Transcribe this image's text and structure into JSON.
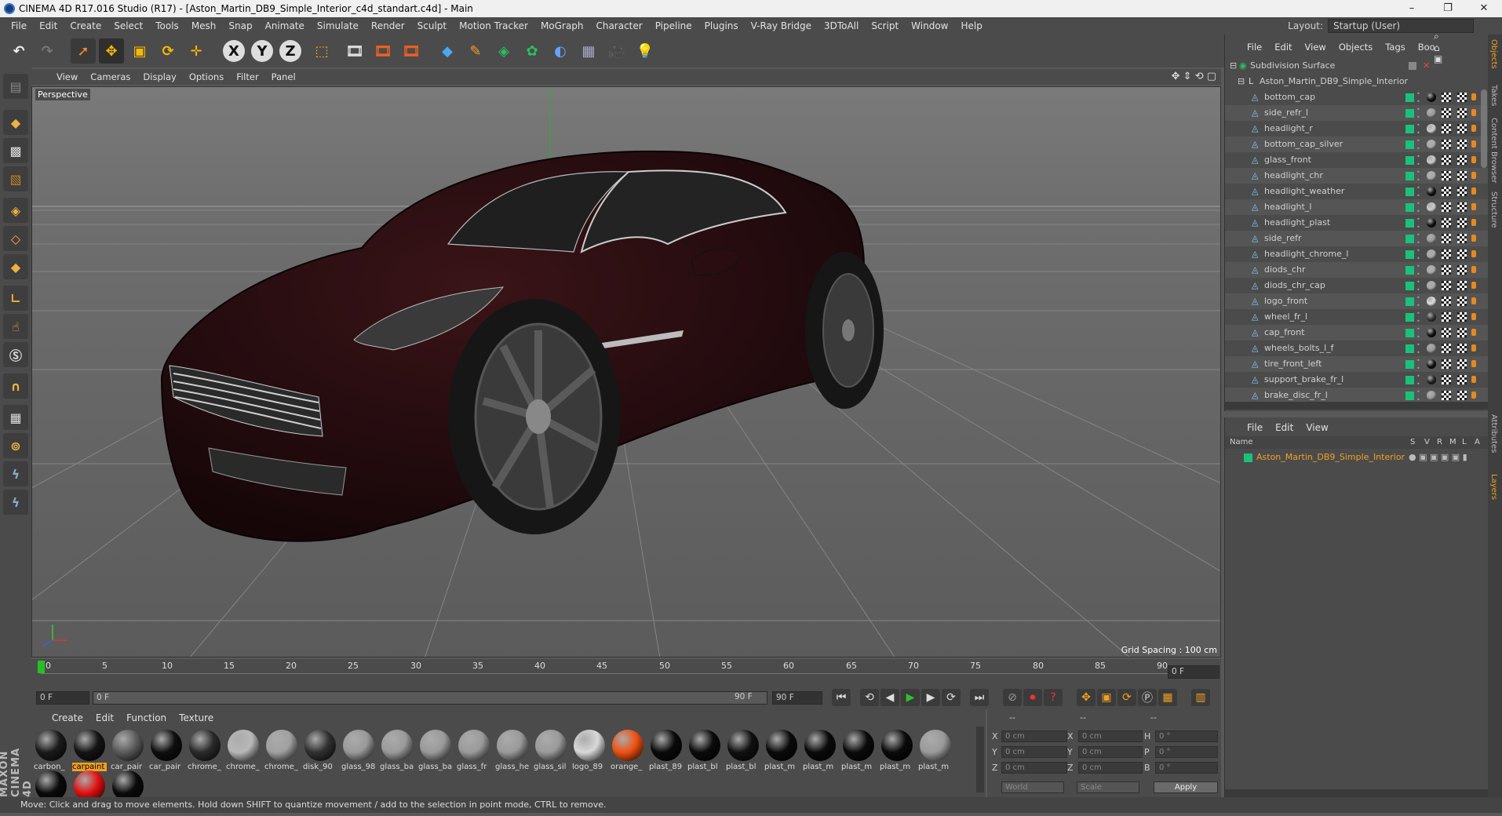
{
  "window": {
    "title": "CINEMA 4D R17.016 Studio (R17) - [Aston_Martin_DB9_Simple_Interior_c4d_standart.c4d] - Main"
  },
  "menu": [
    "File",
    "Edit",
    "Create",
    "Select",
    "Tools",
    "Mesh",
    "Snap",
    "Animate",
    "Simulate",
    "Render",
    "Sculpt",
    "Motion Tracker",
    "MoGraph",
    "Character",
    "Pipeline",
    "Plugins",
    "V-Ray Bridge",
    "3DToAll",
    "Script",
    "Window",
    "Help"
  ],
  "layout": {
    "label": "Layout:",
    "value": "Startup (User)"
  },
  "viewport": {
    "menu": [
      "View",
      "Cameras",
      "Display",
      "Options",
      "Filter",
      "Panel"
    ],
    "camera": "Perspective",
    "grid_spacing": "Grid Spacing : 100 cm"
  },
  "timeline": {
    "ticks": [
      "0",
      "5",
      "10",
      "15",
      "20",
      "25",
      "30",
      "35",
      "40",
      "45",
      "50",
      "55",
      "60",
      "65",
      "70",
      "75",
      "80",
      "85",
      "90"
    ],
    "current_frame": "0 F",
    "start_field": "0 F",
    "slider_start": "0 F",
    "slider_end": "90 F",
    "end_field": "90 F"
  },
  "materials": {
    "menu": [
      "Create",
      "Edit",
      "Function",
      "Texture"
    ],
    "items": [
      {
        "label": "carbon_",
        "color": "#1a1a1a"
      },
      {
        "label": "carpaint",
        "color": "#141414",
        "selected": true
      },
      {
        "label": "car_pair",
        "color": "#5a5a5a"
      },
      {
        "label": "car_pair",
        "color": "#0f0f0f"
      },
      {
        "label": "chrome_",
        "color": "#2a2a2a"
      },
      {
        "label": "chrome_",
        "color": "#b8b8b8"
      },
      {
        "label": "chrome_",
        "color": "#a0a0a0"
      },
      {
        "label": "disk_90",
        "color": "#303030"
      },
      {
        "label": "glass_98",
        "color": "#9a9a9a"
      },
      {
        "label": "glass_ba",
        "color": "#9a9a9a"
      },
      {
        "label": "glass_ba",
        "color": "#9a9a9a"
      },
      {
        "label": "glass_fr",
        "color": "#9a9a9a"
      },
      {
        "label": "glass_he",
        "color": "#9a9a9a"
      },
      {
        "label": "glass_sil",
        "color": "#9a9a9a"
      },
      {
        "label": "logo_89",
        "color": "#d8d8d8"
      },
      {
        "label": "orange_",
        "color": "#f05010"
      },
      {
        "label": "plast_89",
        "color": "#0a0a0a"
      },
      {
        "label": "plast_bl",
        "color": "#0a0a0a"
      },
      {
        "label": "plast_bl",
        "color": "#101010"
      },
      {
        "label": "plast_m",
        "color": "#0a0a0a"
      },
      {
        "label": "plast_m",
        "color": "#0a0a0a"
      },
      {
        "label": "plast_m",
        "color": "#0a0a0a"
      },
      {
        "label": "plast_m",
        "color": "#0a0a0a"
      },
      {
        "label": "plast_m",
        "color": "#9a9a9a"
      },
      {
        "label": "",
        "color": "#0a0a0a"
      },
      {
        "label": "",
        "color": "#e01010"
      },
      {
        "label": "",
        "color": "#0a0a0a"
      }
    ]
  },
  "coords": {
    "header": [
      "--",
      "--",
      "--"
    ],
    "rows": [
      {
        "a": "X",
        "av": "0 cm",
        "b": "X",
        "bv": "0 cm",
        "c": "H",
        "cv": "0 °"
      },
      {
        "a": "Y",
        "av": "0 cm",
        "b": "Y",
        "bv": "0 cm",
        "c": "P",
        "cv": "0 °"
      },
      {
        "a": "Z",
        "av": "0 cm",
        "b": "Z",
        "bv": "0 cm",
        "c": "B",
        "cv": "0 °"
      }
    ],
    "space": "World",
    "mode": "Scale",
    "apply": "Apply"
  },
  "objects": {
    "menu": [
      "File",
      "Edit",
      "View",
      "Objects",
      "Tags",
      "Boo"
    ],
    "root": "Subdivision Surface",
    "group": "Aston_Martin_DB9_Simple_Interior",
    "children": [
      {
        "name": "bottom_cap",
        "ball": "#111"
      },
      {
        "name": "side_refr_l",
        "ball": "#999"
      },
      {
        "name": "headlight_r",
        "ball": "#ccc"
      },
      {
        "name": "bottom_cap_silver",
        "ball": "#aaa"
      },
      {
        "name": "glass_front",
        "ball": "#ccc"
      },
      {
        "name": "headlight_chr",
        "ball": "#aaa"
      },
      {
        "name": "headlight_weather",
        "ball": "#111"
      },
      {
        "name": "headlight_l",
        "ball": "#ccc"
      },
      {
        "name": "headlight_plast",
        "ball": "#111"
      },
      {
        "name": "side_refr",
        "ball": "#999"
      },
      {
        "name": "headlight_chrome_l",
        "ball": "#aaa"
      },
      {
        "name": "diods_chr",
        "ball": "#aaa"
      },
      {
        "name": "diods_chr_cap",
        "ball": "#aaa"
      },
      {
        "name": "logo_front",
        "ball": "#ddd"
      },
      {
        "name": "wheel_fr_l",
        "ball": "#333"
      },
      {
        "name": "cap_front",
        "ball": "#111"
      },
      {
        "name": "wheels_bolts_l_f",
        "ball": "#999"
      },
      {
        "name": "tire_front_left",
        "ball": "#111"
      },
      {
        "name": "support_brake_fr_l",
        "ball": "#222"
      },
      {
        "name": "brake_disc_fr_l",
        "ball": "#999"
      }
    ]
  },
  "layers": {
    "menu": [
      "File",
      "Edit",
      "View"
    ],
    "cols": [
      "Name",
      "S",
      "V",
      "R",
      "M",
      "L",
      "A"
    ],
    "item": "Aston_Martin_DB9_Simple_Interior"
  },
  "right_tabs": [
    "Objects",
    "Takes",
    "Content Browser",
    "Structure",
    "Attributes",
    "Layers"
  ],
  "brand": "MAXON CINEMA 4D",
  "status": "Move: Click and drag to move elements. Hold down SHIFT to quantize movement / add to the selection in point mode, CTRL to remove."
}
